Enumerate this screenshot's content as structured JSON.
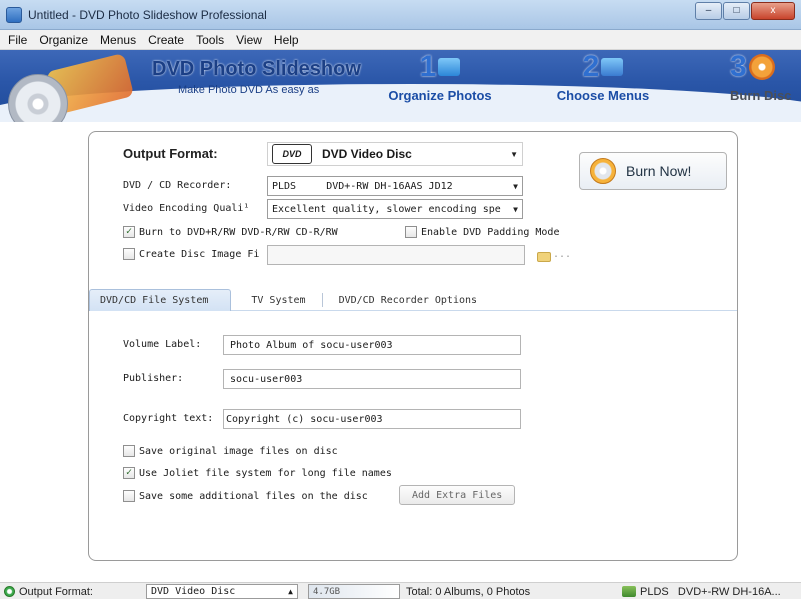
{
  "window": {
    "title": "Untitled - DVD Photo Slideshow Professional",
    "controls": {
      "minimize": "–",
      "maximize": "□",
      "close": "x"
    }
  },
  "menu": [
    "File",
    "Organize",
    "Menus",
    "Create",
    "Tools",
    "View",
    "Help"
  ],
  "banner": {
    "brand": "DVD Photo Slideshow",
    "tagline": "Make Photo DVD As easy as",
    "steps": [
      {
        "num": "1",
        "label": "Organize Photos"
      },
      {
        "num": "2",
        "label": "Choose Menus"
      },
      {
        "num": "3",
        "label": "Burn Disc"
      }
    ]
  },
  "output": {
    "format_label": "Output Format:",
    "disc_logo": "DVD",
    "format_value": "DVD Video Disc",
    "recorder_label": "DVD / CD Recorder:",
    "recorder_brand": "PLDS",
    "recorder_value": "DVD+-RW DH-16AAS JD12",
    "encoding_label": "Video Encoding Quali¹",
    "encoding_value": "Excellent quality, slower encoding spe",
    "burn_to_label": "Burn to DVD+R/RW DVD-R/RW CD-R/RW",
    "burn_to_checked": true,
    "padding_label": "Enable DVD Padding Mode",
    "padding_checked": false,
    "image_label": "Create Disc Image Fi",
    "image_checked": false,
    "image_path": "",
    "browse": "..."
  },
  "burn_button": {
    "label": "Burn Now!"
  },
  "tabs": [
    "DVD/CD File System",
    "TV System",
    "DVD/CD Recorder Options"
  ],
  "filesystem": {
    "volume_label": "Volume Label:",
    "volume_value": "Photo Album of socu-user003",
    "publisher_label": "Publisher:",
    "publisher_value": "socu-user003",
    "copyright_label": "Copyright text:",
    "copyright_value": "Copyright (c) socu-user003",
    "opt_save_original": "Save original image files on disc",
    "opt_save_original_checked": false,
    "opt_joliet": "Use Joliet file system for long file names",
    "opt_joliet_checked": true,
    "opt_additional": "Save some additional files on the disc",
    "opt_additional_checked": false,
    "add_extra_button": "Add Extra Files"
  },
  "statusbar": {
    "format_label": "Output Format:",
    "format_value": "DVD Video Disc",
    "capacity_text": "4.7GB",
    "totals": "Total: 0 Albums, 0 Photos",
    "drive_brand": "PLDS",
    "drive_model": "DVD+-RW DH-16A..."
  },
  "colors": {
    "banner": "#2a56a8",
    "accent": "#2f6fd0",
    "check": "#2a6a2a"
  }
}
